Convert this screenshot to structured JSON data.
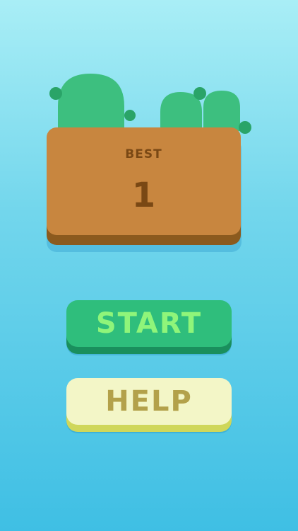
{
  "scoreboard": {
    "best_label": "BEST",
    "best_value": "1"
  },
  "buttons": {
    "start_label": "START",
    "help_label": "HELP"
  },
  "colors": {
    "sky_top": "#a9eef6",
    "sky_bottom": "#3fbfe4",
    "board": "#c8863f",
    "board_edge": "#8b5a1e",
    "board_text": "#7a4814",
    "cactus": "#3dbf7f",
    "cactus_dark": "#2aa468",
    "start_button": "#2fbe7c",
    "start_text": "#8ff57a",
    "help_button": "#f3f6c7",
    "help_text": "#b3a14a"
  }
}
